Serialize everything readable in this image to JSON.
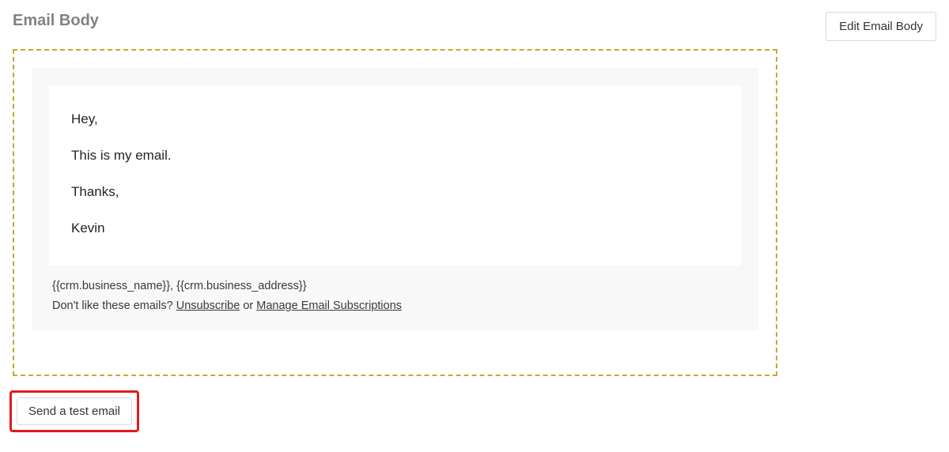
{
  "section": {
    "title": "Email Body",
    "edit_button": "Edit Email Body",
    "send_test_button": "Send a test email"
  },
  "email": {
    "lines": {
      "greeting": "Hey,",
      "body": "This is my email.",
      "thanks": "Thanks,",
      "signature": "Kevin"
    },
    "footer": {
      "merge_line": "{{crm.business_name}}, {{crm.business_address}}",
      "unsubscribe_prefix": "Don't like these emails? ",
      "unsubscribe_link": "Unsubscribe",
      "unsubscribe_middle": " or ",
      "manage_link": "Manage Email Subscriptions"
    }
  }
}
